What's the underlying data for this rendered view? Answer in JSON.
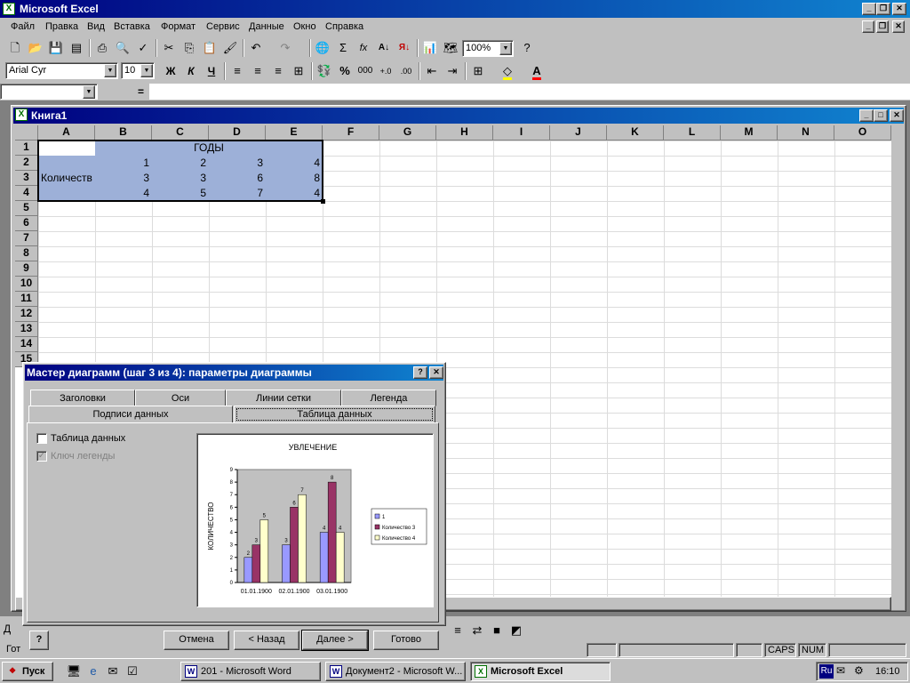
{
  "app": {
    "title": "Microsoft Excel",
    "workbook_title": "Книга1"
  },
  "menu": [
    "Файл",
    "Правка",
    "Вид",
    "Вставка",
    "Формат",
    "Сервис",
    "Данные",
    "Окно",
    "Справка"
  ],
  "toolbar": {
    "zoom": "100%",
    "font": "Arial Cyr",
    "font_size": "10",
    "bold": "Ж",
    "italic": "К",
    "underline": "Ч",
    "percent": "%",
    "thousands": "000",
    "sum": "Σ",
    "fx": "fx",
    "equals": "="
  },
  "columns": [
    "A",
    "B",
    "C",
    "D",
    "E",
    "F",
    "G",
    "H",
    "I",
    "J",
    "K",
    "L",
    "M",
    "N",
    "O"
  ],
  "rows": [
    "1",
    "2",
    "3",
    "4",
    "5",
    "6",
    "7",
    "8",
    "9",
    "10",
    "11",
    "12",
    "13",
    "14",
    "15"
  ],
  "cells": {
    "years_header": "ГОДЫ",
    "a3": "Количеств",
    "row2": [
      "1",
      "2",
      "3",
      "4"
    ],
    "row3": [
      "3",
      "3",
      "6",
      "8"
    ],
    "row4": [
      "4",
      "5",
      "7",
      "4"
    ]
  },
  "dialog": {
    "title": "Мастер диаграмм (шаг 3 из 4): параметры диаграммы",
    "help": "?",
    "tabs_back": [
      "Заголовки",
      "Оси",
      "Линии сетки",
      "Легенда"
    ],
    "tabs_front": [
      "Подписи данных",
      "Таблица данных"
    ],
    "checkbox_table": "Таблица данных",
    "checkbox_legend_key": "Ключ легенды",
    "buttons": {
      "cancel": "Отмена",
      "back": "< Назад",
      "next": "Далее >",
      "finish": "Готово"
    }
  },
  "chart_data": {
    "type": "bar",
    "title": "УВЛЕЧЕНИЕ",
    "ylabel": "КОЛИЧЕСТВО",
    "xlabel": "",
    "categories": [
      "01.01.1900",
      "02.01.1900",
      "03.01.1900"
    ],
    "ylim": [
      0,
      9
    ],
    "yticks": [
      "0",
      "1",
      "2",
      "3",
      "4",
      "5",
      "6",
      "7",
      "8",
      "9"
    ],
    "series": [
      {
        "name": "1",
        "values": [
          2,
          3,
          4
        ],
        "color": "#9999ff"
      },
      {
        "name": "Количество 3",
        "values": [
          3,
          6,
          8
        ],
        "color": "#993366"
      },
      {
        "name": "Количество 4",
        "values": [
          5,
          7,
          4
        ],
        "color": "#ffffcc"
      }
    ],
    "legend_position": "right",
    "plot_background": "#c0c0c0"
  },
  "statusbar": {
    "ready": "Гот",
    "caps": "CAPS",
    "num": "NUM",
    "left_cut": "Д"
  },
  "taskbar": {
    "start": "Пуск",
    "tasks": [
      "201 - Microsoft Word",
      "Документ2 - Microsoft W...",
      "Microsoft Excel"
    ],
    "lang": "Ru",
    "clock": "16:10"
  }
}
